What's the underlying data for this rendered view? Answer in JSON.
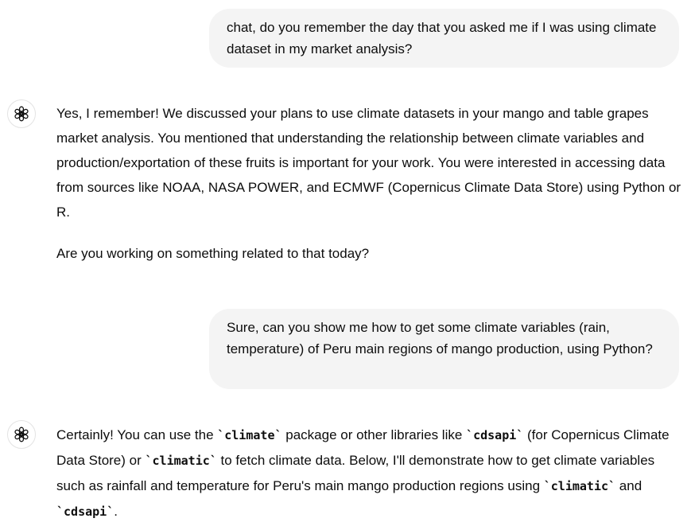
{
  "conversation": {
    "user_message_1": "chat, do you remember the day that you asked me if I was using climate dataset in my market analysis?",
    "assistant_message_1": {
      "paragraph_1": "Yes, I remember! We discussed your plans to use climate datasets in your mango and table grapes market analysis. You mentioned that understanding the relationship between climate variables and production/exportation of these fruits is important for your work. You were interested in accessing data from sources like NOAA, NASA POWER, and ECMWF (Copernicus Climate Data Store) using Python or R.",
      "paragraph_2": "Are you working on something related to that today?"
    },
    "user_message_2": "Sure, can you show me how to get some climate variables (rain, temperature) of Peru main regions of mango production, using Python?",
    "assistant_message_2": {
      "t1": "Certainly! You can use the ",
      "code1": "`climate`",
      "t2": " package or other libraries like ",
      "code2": "`cdsapi`",
      "t3": " (for Copernicus Climate Data Store) or ",
      "code3": "`climatic`",
      "t4": " to fetch climate data. Below, I'll demonstrate how to get climate variables such as rainfall and temperature for Peru's main mango production regions using ",
      "code4": "`climatic`",
      "t5": " and ",
      "code5": "`cdsapi`",
      "t6": "."
    },
    "assistant_avatar_icon": "openai-logo-icon"
  }
}
